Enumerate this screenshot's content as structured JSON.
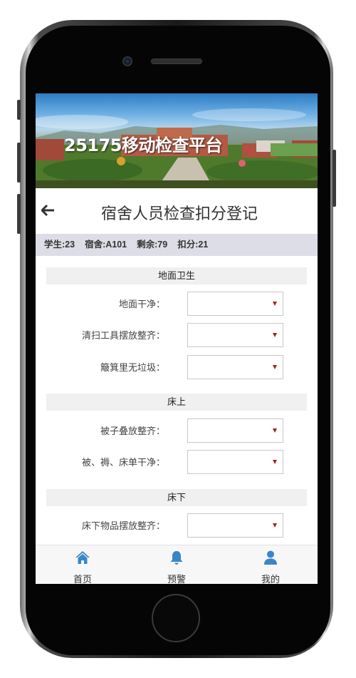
{
  "banner": {
    "title": "25175移动检查平台"
  },
  "header": {
    "title": "宿舍人员检查扣分登记"
  },
  "stats": {
    "student": "学生:23",
    "dorm": "宿舍:A101",
    "remaining": "剩余:79",
    "deduction": "扣分:21"
  },
  "sections": [
    {
      "title": "地面卫生",
      "items": [
        {
          "label": "地面干净：",
          "value": ""
        },
        {
          "label": "清扫工具摆放整齐：",
          "value": ""
        },
        {
          "label": "簸箕里无垃圾：",
          "value": ""
        }
      ]
    },
    {
      "title": "床上",
      "items": [
        {
          "label": "被子叠放整齐：",
          "value": ""
        },
        {
          "label": "被、褥、床单干净：",
          "value": ""
        }
      ]
    },
    {
      "title": "床下",
      "items": [
        {
          "label": "床下物品摆放整齐：",
          "value": ""
        }
      ]
    }
  ],
  "tabbar": {
    "home": "首页",
    "alert": "预警",
    "mine": "我的"
  },
  "icons": {
    "back": "arrow-left-icon",
    "home": "home-icon",
    "alert": "bell-icon",
    "mine": "user-icon",
    "select": "caret-down-icon"
  },
  "colors": {
    "accent": "#3a86c8",
    "caret": "#b01c1c",
    "stats_bg": "#dcdde6",
    "section_bg": "#f0f0f1"
  }
}
